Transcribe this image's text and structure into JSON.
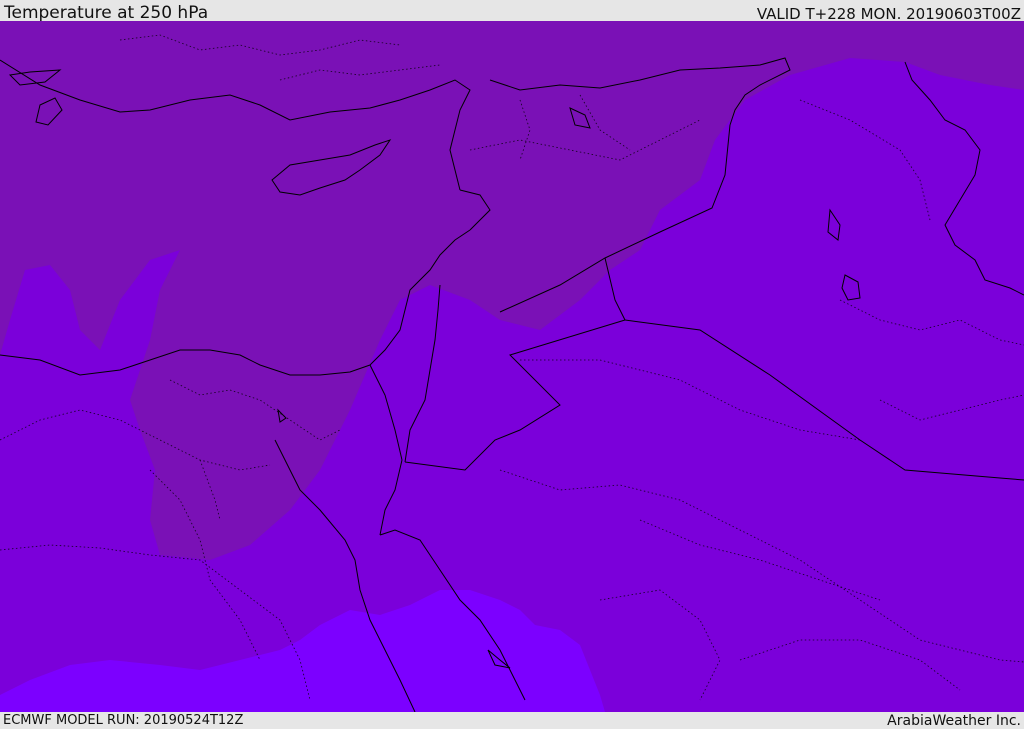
{
  "header": {
    "title": "Temperature at 250 hPa",
    "valid": "VALID T+228 MON. 20190603T00Z"
  },
  "footer": {
    "model_run": "ECMWF MODEL RUN: 20190524T12Z",
    "credit": "ArabiaWeather Inc."
  },
  "map": {
    "fill_colors": {
      "darker_band": "#7a11b6",
      "mid_band": "#7b00da",
      "lighter_band": "#7c00ff"
    },
    "boundary_color": "#000000"
  }
}
